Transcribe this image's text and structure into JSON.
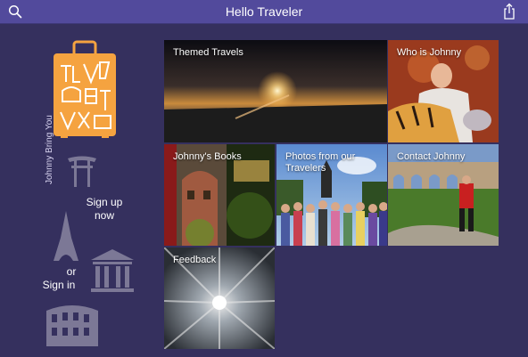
{
  "topbar": {
    "title": "Hello Traveler"
  },
  "sidebar": {
    "brand_vertical": "Johnny Bring You",
    "signup_line1": "Sign up",
    "signup_line2": "now",
    "or_label": "or",
    "signin_label": "Sign in"
  },
  "tiles": {
    "themed": "Themed Travels",
    "who": "Who is Johnny",
    "books": "Johnny's Books",
    "photos": "Photos from our Travelers",
    "contact": "Contact Johnny",
    "feedback": "Feedback"
  },
  "colors": {
    "topbar": "#524a9c",
    "background": "#35305e",
    "suitcase": "#f5a340"
  }
}
